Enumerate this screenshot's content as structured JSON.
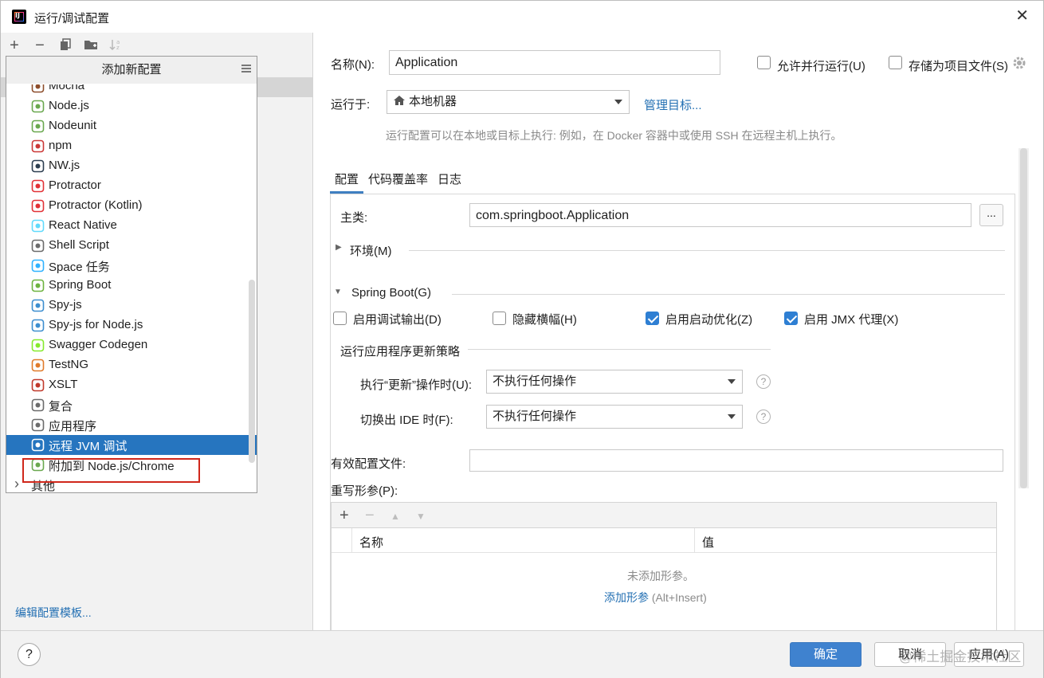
{
  "window": {
    "title": "运行/调试配置",
    "app_icon_text": "IJ"
  },
  "left": {
    "toolbar": [
      "add-icon",
      "remove-icon",
      "copy-icon",
      "folder-icon",
      "sort-icon"
    ],
    "edit_templates": "编辑配置模板..."
  },
  "popup": {
    "header": "添加新配置",
    "items": [
      {
        "label": "Mocha",
        "icon": "mocha-icon",
        "color": "#8d4d2b"
      },
      {
        "label": "Node.js",
        "icon": "nodejs-icon",
        "color": "#6aa84f"
      },
      {
        "label": "Nodeunit",
        "icon": "nodeunit-icon",
        "color": "#6aa84f"
      },
      {
        "label": "npm",
        "icon": "npm-icon",
        "color": "#cb3837"
      },
      {
        "label": "NW.js",
        "icon": "nwjs-icon",
        "color": "#2c3e50"
      },
      {
        "label": "Protractor",
        "icon": "protractor-icon",
        "color": "#e23237"
      },
      {
        "label": "Protractor (Kotlin)",
        "icon": "protractor-kotlin-icon",
        "color": "#e23237"
      },
      {
        "label": "React Native",
        "icon": "react-icon",
        "color": "#61dafb"
      },
      {
        "label": "Shell Script",
        "icon": "shell-icon",
        "color": "#6b6b6b"
      },
      {
        "label": "Space 任务",
        "icon": "space-icon",
        "color": "#2fb2ff"
      },
      {
        "label": "Spring Boot",
        "icon": "spring-boot-icon",
        "color": "#6db33f"
      },
      {
        "label": "Spy-js",
        "icon": "spyjs-icon",
        "color": "#3d8ecf"
      },
      {
        "label": "Spy-js for Node.js",
        "icon": "spyjs-node-icon",
        "color": "#3d8ecf"
      },
      {
        "label": "Swagger Codegen",
        "icon": "swagger-icon",
        "color": "#85ea2d"
      },
      {
        "label": "TestNG",
        "icon": "testng-icon",
        "color": "#e07b2b"
      },
      {
        "label": "XSLT",
        "icon": "xslt-icon",
        "color": "#c0392b"
      },
      {
        "label": "复合",
        "icon": "compound-icon",
        "color": "#6b6b6b"
      },
      {
        "label": "应用程序",
        "icon": "application-icon",
        "color": "#6b6b6b"
      },
      {
        "label": "远程 JVM 调试",
        "icon": "remote-jvm-icon",
        "color": "#ffffff",
        "selected": true
      },
      {
        "label": "附加到 Node.js/Chrome",
        "icon": "attach-node-icon",
        "color": "#6aa84f"
      },
      {
        "label": "其他",
        "icon": "chevron-right-icon",
        "color": "#555555"
      }
    ]
  },
  "form": {
    "name_label": "名称(N):",
    "name_value": "Application",
    "allow_parallel": "允许并行运行(U)",
    "store_as_file": "存储为项目文件(S)",
    "run_on_label": "运行于:",
    "run_on_value": "本地机器",
    "manage_targets": "管理目标...",
    "hint": "运行配置可以在本地或目标上执行: 例如，在 Docker 容器中或使用 SSH 在远程主机上执行。",
    "tabs": [
      "配置",
      "代码覆盖率",
      "日志"
    ],
    "main_class_label": "主类:",
    "main_class_value": "com.springboot.Application",
    "browse_label": "...",
    "env_label": "环境(M)",
    "spring_boot_label": "Spring Boot(G)",
    "checkboxes": [
      {
        "label": "启用调试输出(D)",
        "checked": false
      },
      {
        "label": "隐藏横幅(H)",
        "checked": false
      },
      {
        "label": "启用启动优化(Z)",
        "checked": true
      },
      {
        "label": "启用 JMX 代理(X)",
        "checked": true
      }
    ],
    "update_policy_label": "运行应用程序更新策略",
    "on_update_label": "执行“更新”操作时(U):",
    "on_update_value": "不执行任何操作",
    "on_frame_label": "切换出 IDE 时(F):",
    "on_frame_value": "不执行任何操作",
    "active_profiles_label": "有效配置文件:",
    "active_profiles_value": "",
    "override_label": "重写形参(P):",
    "table_col_name": "名称",
    "table_col_value": "值",
    "no_params": "未添加形参。",
    "add_param": "添加形参",
    "add_param_shortcut": "(Alt+Insert)"
  },
  "footer": {
    "help": "?",
    "ok": "确定",
    "cancel": "取消",
    "apply": "应用(A)",
    "watermark": "@稀土掘金技术社区"
  },
  "colors": {
    "accent": "#2675bf",
    "link": "#2470b3",
    "primary_button": "#3f82cf",
    "highlight": "#d0271b"
  }
}
